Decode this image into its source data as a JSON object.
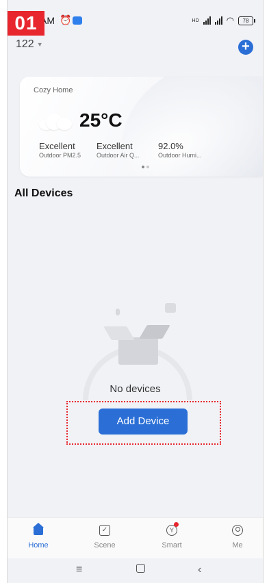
{
  "step_badge": "01",
  "status_bar": {
    "time": "AM",
    "network": "HD",
    "battery": "78"
  },
  "header": {
    "home_selector": "122"
  },
  "weather_card": {
    "home_name": "Cozy Home",
    "temperature": "25°C",
    "metrics": [
      {
        "value": "Excellent",
        "label": "Outdoor PM2.5"
      },
      {
        "value": "Excellent",
        "label": "Outdoor Air Q..."
      },
      {
        "value": "92.0%",
        "label": "Outdoor Humi..."
      }
    ],
    "page_dots": 2,
    "active_dot": 0
  },
  "main": {
    "section_title": "All Devices",
    "empty_text": "No devices",
    "add_device_label": "Add Device"
  },
  "tabs": [
    {
      "label": "Home",
      "icon": "home-icon",
      "active": true
    },
    {
      "label": "Scene",
      "icon": "scene-icon",
      "active": false
    },
    {
      "label": "Smart",
      "icon": "smart-icon",
      "active": false
    },
    {
      "label": "Me",
      "icon": "profile-icon",
      "active": false
    }
  ],
  "system_nav": {
    "menu_glyph": "≡",
    "back_glyph": "‹"
  },
  "colors": {
    "accent": "#2b6fd6",
    "badge": "#e8262d",
    "background": "#f1f2f6"
  }
}
